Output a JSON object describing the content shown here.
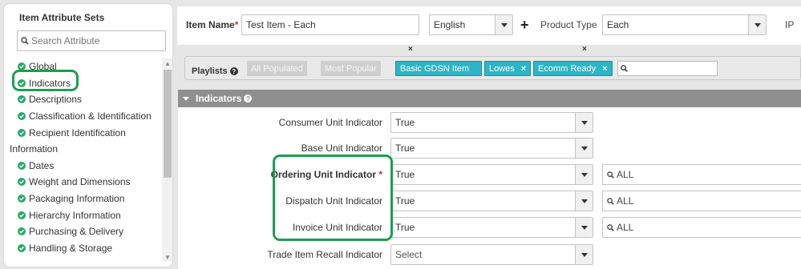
{
  "sidebar": {
    "title": "Item Attribute Sets",
    "search_placeholder": "Search Attribute",
    "items": [
      {
        "label": "Global",
        "checked": true
      },
      {
        "label": "Indicators",
        "checked": true
      },
      {
        "label": "Descriptions",
        "checked": true
      },
      {
        "label": "Classification & Identification",
        "checked": true
      },
      {
        "label": "Recipient Identification",
        "checked": true
      },
      {
        "label": "Information",
        "checked": false
      },
      {
        "label": "Dates",
        "checked": true
      },
      {
        "label": "Weight and Dimensions",
        "checked": true
      },
      {
        "label": "Packaging Information",
        "checked": true
      },
      {
        "label": "Hierarchy Information",
        "checked": true
      },
      {
        "label": "Purchasing & Delivery",
        "checked": true
      },
      {
        "label": "Handling & Storage",
        "checked": true
      }
    ]
  },
  "header": {
    "item_name_label": "Item Name",
    "required_mark": "*",
    "item_name_value": "Test Item - Each",
    "language_value": "English",
    "product_type_label": "Product Type",
    "product_type_value": "Each",
    "ip_label": "IP",
    "remove_mark": "×"
  },
  "playlists": {
    "label": "Playlists",
    "chips_inactive": [
      "All Populated",
      "Most Popular"
    ],
    "chips_active": [
      {
        "label": "Basic GDSN Item",
        "removable": false
      },
      {
        "label": "Lowes",
        "removable": true
      },
      {
        "label": "Ecomm Ready",
        "removable": true
      }
    ],
    "remove_icon": "×"
  },
  "section": {
    "title": "Indicators"
  },
  "form": {
    "rows": [
      {
        "label": "Consumer Unit Indicator",
        "value": "True",
        "required": false,
        "has_search": false
      },
      {
        "label": "Base Unit Indicator",
        "value": "True",
        "required": false,
        "has_search": false
      },
      {
        "label": "Ordering Unit Indicator",
        "value": "True",
        "required": true,
        "has_search": true,
        "search_value": "ALL"
      },
      {
        "label": "Dispatch Unit Indicator",
        "value": "True",
        "required": false,
        "has_search": true,
        "search_value": "ALL"
      },
      {
        "label": "Invoice Unit Indicator",
        "value": "True",
        "required": false,
        "has_search": true,
        "search_value": "ALL"
      },
      {
        "label": "Trade Item Recall Indicator",
        "value": "Select",
        "required": false,
        "has_search": false
      }
    ]
  },
  "colors": {
    "accent_teal": "#2bb5c6",
    "check_green": "#27a96b",
    "highlight_green": "#1f9d4f",
    "required_red": "#c9302c"
  }
}
